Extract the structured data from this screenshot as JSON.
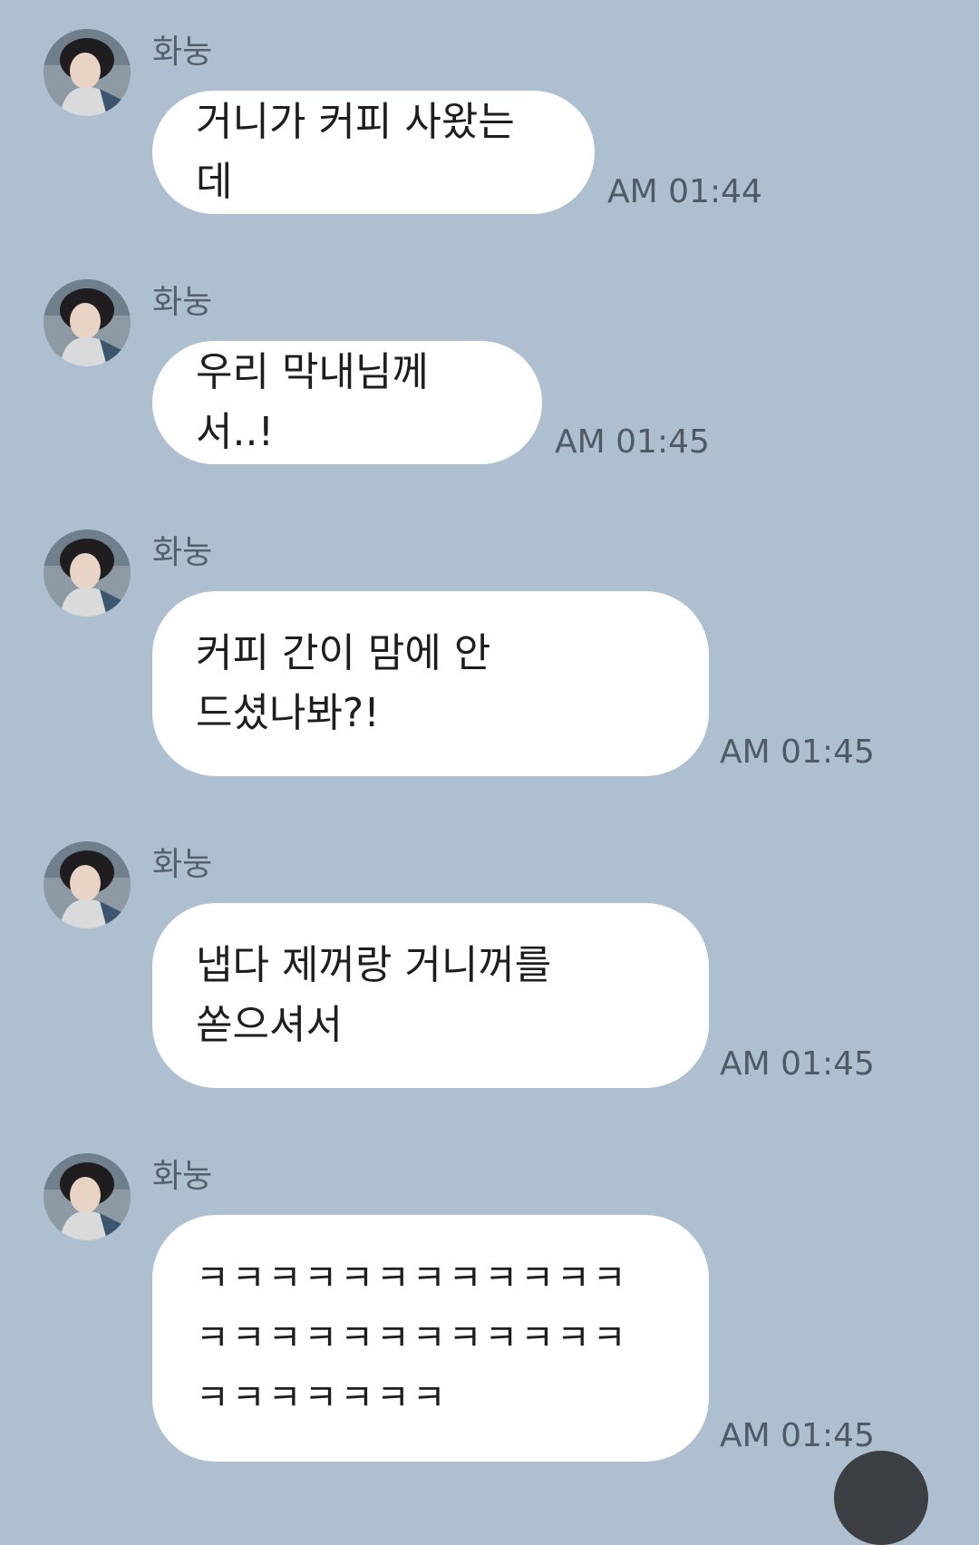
{
  "chat": {
    "messages": [
      {
        "sender": "화눙",
        "text": "거니가 커피 사왔는데",
        "time": "AM 01:44"
      },
      {
        "sender": "화눙",
        "text": "우리 막내님께서..!",
        "time": "AM 01:45"
      },
      {
        "sender": "화눙",
        "text": "커피 간이 맘에 안\n드셨나봐?!",
        "time": "AM 01:45"
      },
      {
        "sender": "화눙",
        "text": "냅다 제꺼랑 거니꺼를\n쏟으셔서",
        "time": "AM 01:45"
      },
      {
        "sender": "화눙",
        "text": "ㅋㅋㅋㅋㅋㅋㅋㅋㅋㅋㅋㅋ\nㅋㅋㅋㅋㅋㅋㅋㅋㅋㅋㅋㅋ\nㅋㅋㅋㅋㅋㅋㅋ",
        "time": "AM 01:45"
      }
    ]
  },
  "colors": {
    "background": "#AEC0D0",
    "bubble": "#FFFFFF",
    "sender_text": "#55606B",
    "time_text": "#4F5A65",
    "scroll_button": "#3C3F43"
  }
}
